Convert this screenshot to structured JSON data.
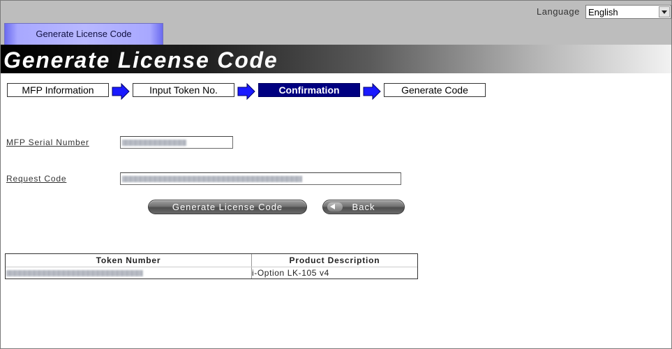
{
  "header": {
    "language_label": "Language",
    "language_value": "English",
    "tab_label": "Generate License Code"
  },
  "banner": {
    "title": "Generate License Code"
  },
  "steps": [
    {
      "label": "MFP Information",
      "active": false
    },
    {
      "label": "Input Token No.",
      "active": false
    },
    {
      "label": "Confirmation",
      "active": true
    },
    {
      "label": "Generate Code",
      "active": false
    }
  ],
  "form": {
    "serial_label": "MFP Serial Number",
    "serial_value": "",
    "request_label": "Request Code",
    "request_value": ""
  },
  "buttons": {
    "generate_label": "Generate License Code",
    "back_label": "Back"
  },
  "table": {
    "headers": [
      "Token Number",
      "Product Description"
    ],
    "rows": [
      {
        "token": "",
        "description": "i-Option LK-105 v4"
      }
    ]
  },
  "colors": {
    "active_step": "#000080",
    "step_arrow": "#1a1aff",
    "tab": "#b8b8ff"
  },
  "icons": {
    "step_arrow": "right-arrow-icon",
    "back": "back-arrow-icon",
    "dropdown": "chevron-down-icon"
  }
}
